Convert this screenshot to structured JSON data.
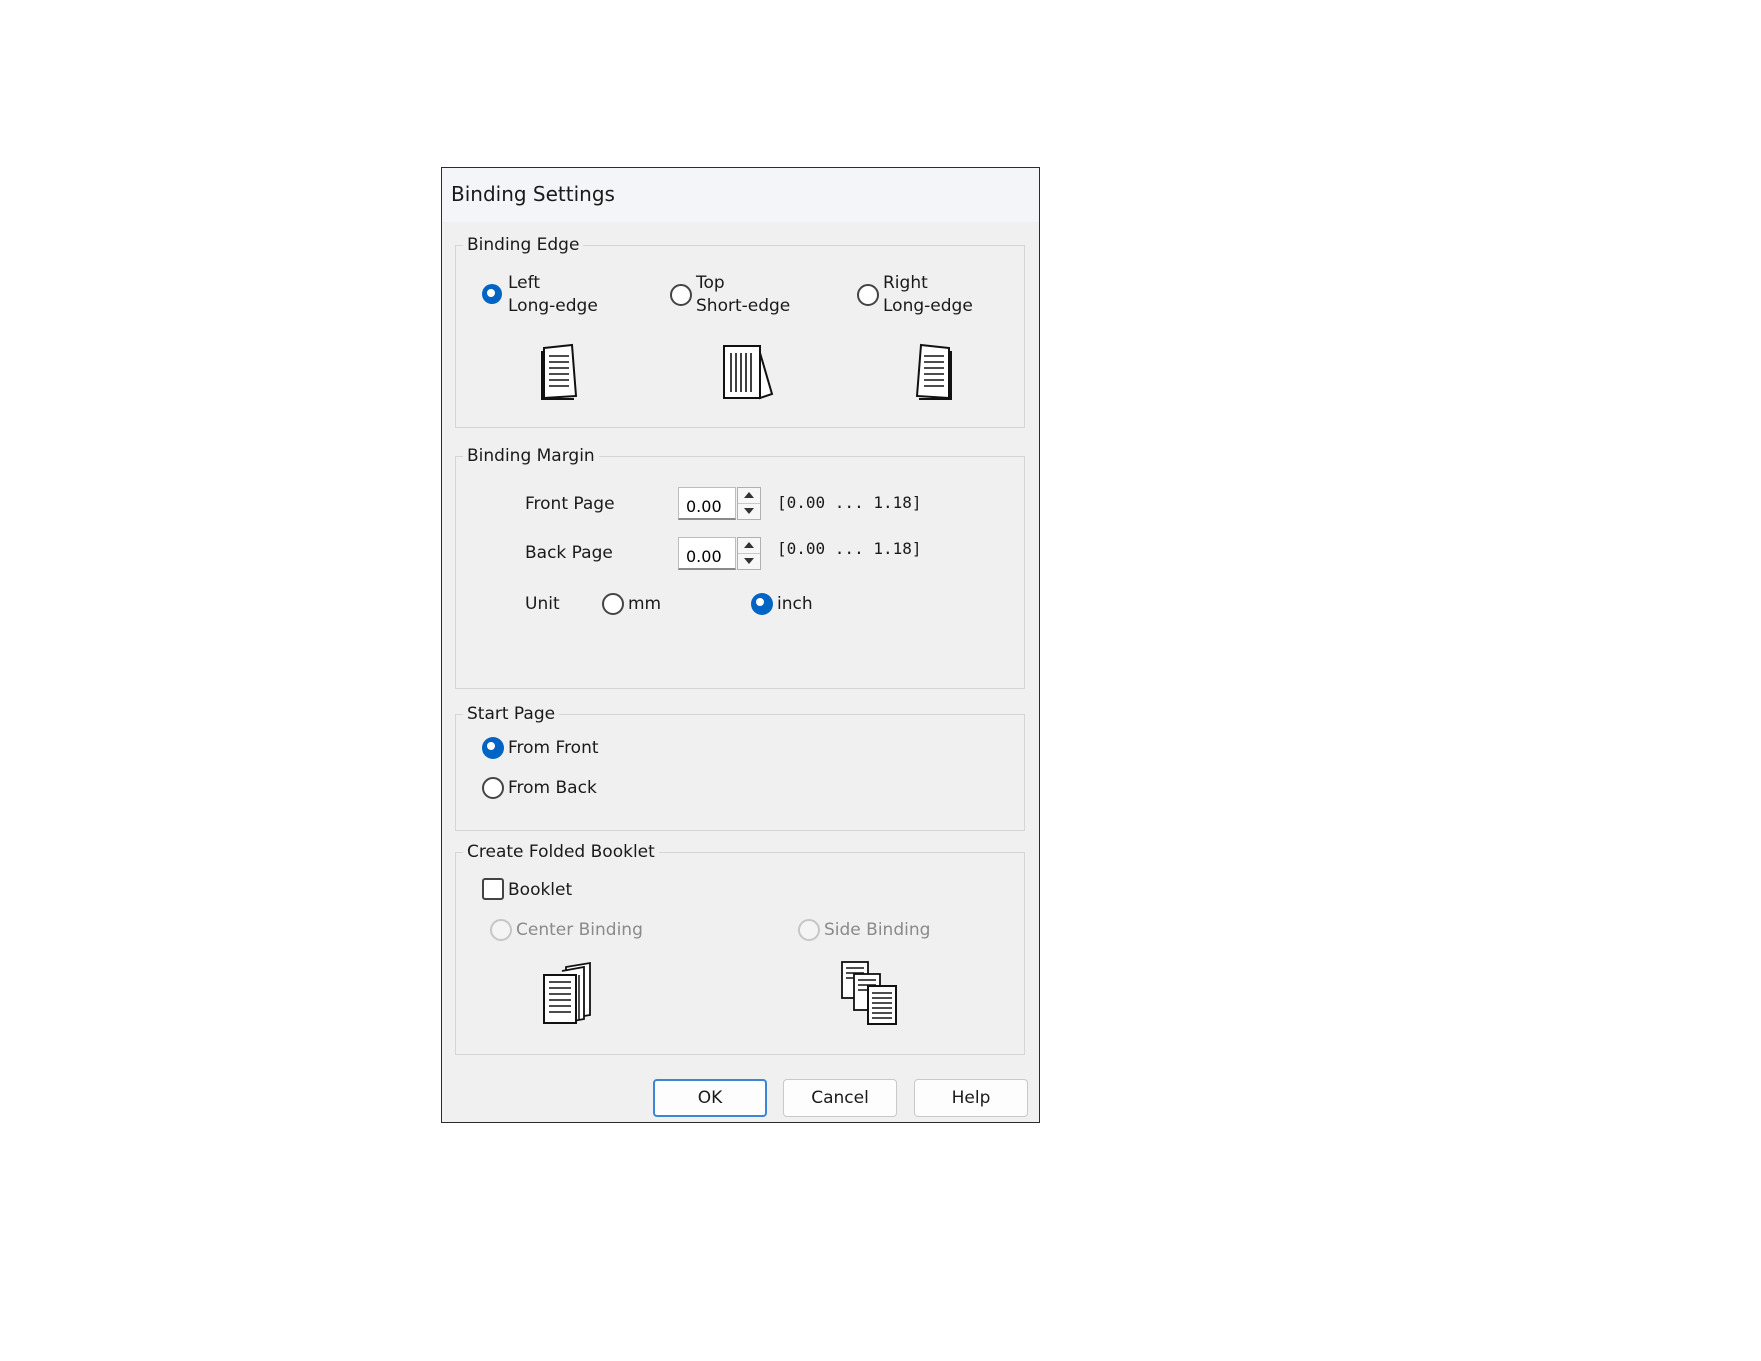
{
  "dialog": {
    "title": "Binding Settings"
  },
  "binding_edge": {
    "legend": "Binding Edge",
    "options": [
      {
        "line1": "Left",
        "line2": "Long-edge",
        "selected": true,
        "icon": "page-left-long-edge-icon"
      },
      {
        "line1": "Top",
        "line2": "Short-edge",
        "selected": false,
        "icon": "page-top-short-edge-icon"
      },
      {
        "line1": "Right",
        "line2": "Long-edge",
        "selected": false,
        "icon": "page-right-long-edge-icon"
      }
    ]
  },
  "binding_margin": {
    "legend": "Binding Margin",
    "front_label": "Front Page",
    "front_value": "0.00",
    "front_range": "[0.00 ... 1.18]",
    "back_label": "Back Page",
    "back_value": "0.00",
    "back_range": "[0.00 ... 1.18]",
    "unit_label": "Unit",
    "unit_mm": "mm",
    "unit_inch": "inch",
    "unit_selected": "inch"
  },
  "start_page": {
    "legend": "Start Page",
    "from_front": "From Front",
    "from_back": "From Back",
    "selected": "From Front"
  },
  "booklet": {
    "legend": "Create Folded Booklet",
    "checkbox_label": "Booklet",
    "checked": false,
    "center_binding": "Center Binding",
    "side_binding": "Side Binding",
    "center_icon": "center-binding-booklet-icon",
    "side_icon": "side-binding-booklet-icon"
  },
  "buttons": {
    "ok": "OK",
    "cancel": "Cancel",
    "help": "Help"
  },
  "colors": {
    "accent": "#0064c4",
    "dialog_bg": "#f0f0f0",
    "ok_border": "#3c86d6"
  }
}
